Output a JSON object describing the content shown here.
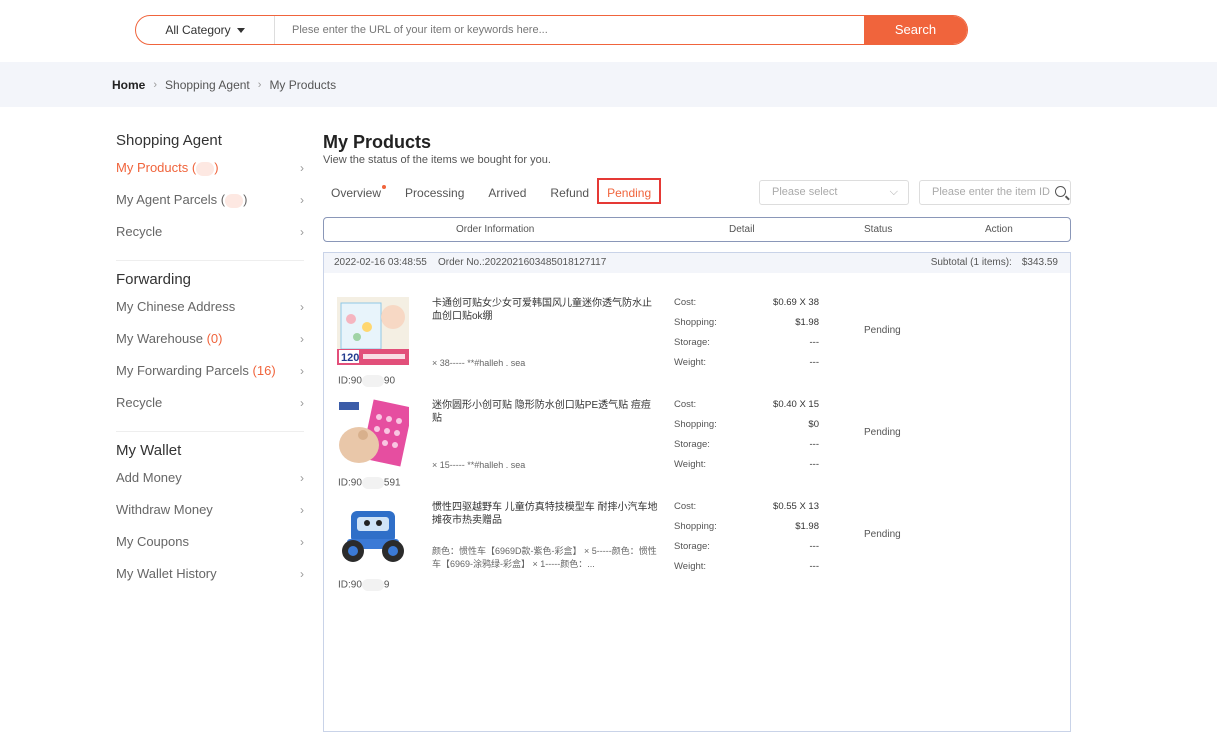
{
  "search": {
    "category": "All Category",
    "placeholder": "Plese enter the URL of your item or keywords here...",
    "button": "Search"
  },
  "breadcrumb": [
    "Home",
    "Shopping Agent",
    "My Products"
  ],
  "sidebar": {
    "groups": [
      {
        "title": "Shopping Agent",
        "items": [
          {
            "label": "My Products (",
            "suffix": ")",
            "masked": true,
            "active": true
          },
          {
            "label": "My Agent Parcels (",
            "suffix": ")",
            "masked": true
          },
          {
            "label": "Recycle"
          }
        ]
      },
      {
        "title": "Forwarding",
        "items": [
          {
            "label": "My Chinese Address"
          },
          {
            "label": "My Warehouse ",
            "count": "(0)"
          },
          {
            "label": "My Forwarding Parcels ",
            "count": "(16)"
          },
          {
            "label": "Recycle"
          }
        ]
      },
      {
        "title": "My Wallet",
        "items": [
          {
            "label": "Add Money"
          },
          {
            "label": "Withdraw Money"
          },
          {
            "label": "My Coupons"
          },
          {
            "label": "My Wallet History"
          }
        ]
      }
    ]
  },
  "main": {
    "title": "My Products",
    "subtitle": "View the status of the items we bought for you.",
    "tabs": [
      "Overview",
      "Processing",
      "Arrived",
      "Refund",
      "Pending"
    ],
    "filter_placeholder": "Please select",
    "item_id_placeholder": "Please enter the item ID",
    "table_headers": [
      "Order Information",
      "Detail",
      "Status",
      "Action"
    ],
    "order": {
      "date": "2022-02-16 03:48:55",
      "order_no": "Order No.:20220216034850181271​17",
      "subtotal_label": "Subtotal (1 items):",
      "subtotal_value": "$343.59",
      "items": [
        {
          "name": "卡通创可贴女少女可爱韩国风儿童迷你透气防水止血创口贴ok绷",
          "qty": "× 38----- **#halleh . sea",
          "id_prefix": "ID:90",
          "id_suffix": "90",
          "cost": "$0.69 X 38",
          "shopping": "$1.98",
          "storage": "---",
          "weight": "---",
          "status": "Pending"
        },
        {
          "name": "迷你圆形小创可贴 隐形防水创口贴PE透气贴 痘痘贴",
          "qty": "× 15----- **#halleh . sea",
          "id_prefix": "ID:90",
          "id_suffix": "591",
          "cost": "$0.40 X 15",
          "shopping": "$0",
          "storage": "---",
          "weight": "---",
          "status": "Pending"
        },
        {
          "name": "惯性四驱越野车 儿童仿真特技模型车 耐摔小汽车地摊夜市热卖赠品",
          "qty": "颜色：惯性车【6969D款-紫色-彩盒】 × 5-----颜色：惯性车【6969-涂鸦绿-彩盒】 × 1-----颜色：...",
          "id_prefix": "ID:90",
          "id_suffix": "9",
          "cost": "$0.55 X 13",
          "shopping": "$1.98",
          "storage": "---",
          "weight": "---",
          "status": "Pending"
        }
      ],
      "detail_labels": [
        "Cost:",
        "Shopping:",
        "Storage:",
        "Weight:"
      ]
    }
  },
  "colors": {
    "accent": "#f0643c",
    "highlight_box": "#e53935",
    "band": "#f3f5fa"
  }
}
